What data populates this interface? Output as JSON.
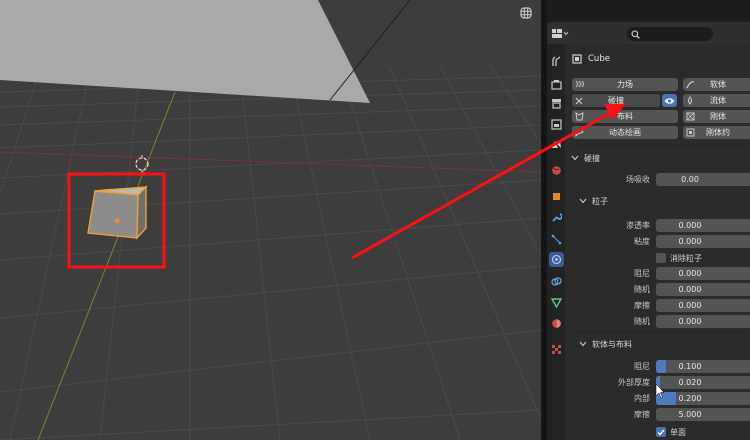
{
  "object": {
    "name": "Cube"
  },
  "physics_buttons": [
    {
      "label": "力场",
      "icon": "forcefield-icon"
    },
    {
      "label": "软体",
      "icon": "softbody-icon"
    },
    {
      "label": "碰撞",
      "icon": "close-icon",
      "active": true
    },
    {
      "label": "流体",
      "icon": "fluid-icon"
    },
    {
      "label": "布料",
      "icon": "cloth-icon"
    },
    {
      "label": "刚体",
      "icon": "rigidbody-icon"
    },
    {
      "label": "动态绘画",
      "icon": "dynamic-paint-icon"
    },
    {
      "label": "刚体约",
      "icon": "rigidbody-constraint-icon"
    }
  ],
  "collision": {
    "title": "碰撞",
    "field_absorption": {
      "label": "场吸收",
      "value": "0.00"
    },
    "particle": {
      "title": "粒子",
      "permeability": {
        "label": "渗透率",
        "value": "0.000"
      },
      "stickiness": {
        "label": "粘度",
        "value": "0.000"
      },
      "kill_particles": {
        "label": "消除粒子",
        "checked": false
      },
      "damping": {
        "label": "阻尼",
        "value": "0.000"
      },
      "damping_random": {
        "label": "随机",
        "value": "0.000"
      },
      "friction": {
        "label": "摩擦",
        "value": "0.000"
      },
      "friction_random": {
        "label": "随机",
        "value": "0.000"
      }
    },
    "softbody_cloth": {
      "title": "软体与布料",
      "damping": {
        "label": "阻尼",
        "value": "0.100",
        "fraction": 0.1
      },
      "thickness_outer": {
        "label": "外部厚度",
        "value": "0.020",
        "fraction": 0.04
      },
      "thickness_inner": {
        "label": "内部",
        "value": "0.200",
        "fraction": 0.2
      },
      "friction": {
        "label": "摩擦",
        "value": "5.000",
        "fraction": 0.0
      },
      "single_sided": {
        "label": "单面",
        "checked": true
      }
    }
  },
  "colors": {
    "accent": "#4b72b3",
    "annotation": "#ff1010",
    "selection": "#ffa030"
  }
}
